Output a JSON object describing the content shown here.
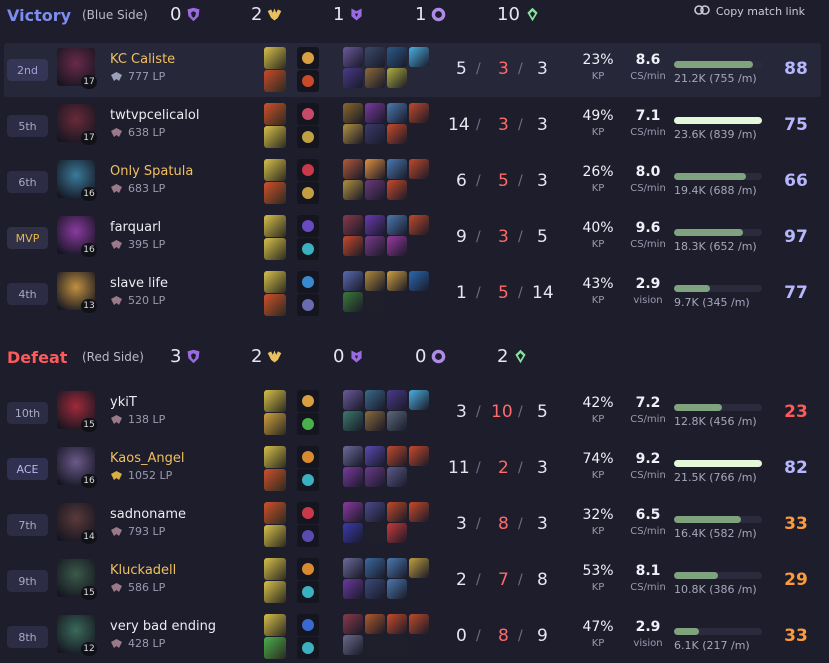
{
  "actions": {
    "copy_link_label": "Copy match link",
    "copy_icon": "link-icon"
  },
  "teams": [
    {
      "result": "Victory",
      "side": "(Blue Side)",
      "result_color": "#7f8cf0",
      "objectives": {
        "barons": "0",
        "dragons": "2",
        "heralds": "1",
        "grubs": "1",
        "turrets": "10"
      },
      "players": [
        {
          "rank": "2nd",
          "name": "KC Caliste",
          "name_gold": true,
          "level": "17",
          "lp": "777 LP",
          "emblem_color": "#9aa0b8",
          "spell_colors": [
            "#d8c04a",
            "#c84a2a"
          ],
          "rune_colors": [
            "#d8a040",
            "#c84a2a"
          ],
          "item_colors": [
            "#6a5a9a",
            "#3a4a6a",
            "#2a5a8a",
            "#4ab0e0",
            "#4a3a8a",
            "#8a6a3a",
            "#b0b040"
          ],
          "kills": "5",
          "deaths": "3",
          "assists": "3",
          "kp": "23%",
          "cs": "8.6",
          "cs_label": "CS/min",
          "dmg_fraction": 0.9,
          "dmg": "21.2K (755 /m)",
          "score": "88",
          "score_color": "#b7b7ff",
          "portrait_color": "#6a2a4a",
          "highlight": true
        },
        {
          "rank": "5th",
          "name": "twtvpcelicalol",
          "name_gold": false,
          "level": "17",
          "lp": "638 LP",
          "emblem_color": "#9a7a8a",
          "spell_colors": [
            "#d0502a",
            "#d8c04a"
          ],
          "rune_colors": [
            "#c84a6a",
            "#c0a040"
          ],
          "item_colors": [
            "#8a6a2a",
            "#7a3aa0",
            "#4a7ab0",
            "#c04a2a",
            "#b09040",
            "#3a3a6a",
            "#c84a2a"
          ],
          "kills": "14",
          "deaths": "3",
          "assists": "3",
          "kp": "49%",
          "cs": "7.1",
          "cs_label": "CS/min",
          "dmg_fraction": 1.0,
          "dmg": "23.6K (839 /m)",
          "score": "75",
          "score_color": "#b7b7ff",
          "portrait_color": "#6a2a3a",
          "highlight": false
        },
        {
          "rank": "6th",
          "name": "Only Spatula",
          "name_gold": true,
          "level": "16",
          "lp": "683 LP",
          "emblem_color": "#9a7a8a",
          "spell_colors": [
            "#d8c04a",
            "#d0502a"
          ],
          "rune_colors": [
            "#c83a4a",
            "#c0a040"
          ],
          "item_colors": [
            "#b05a3a",
            "#e09040",
            "#4a7ab0",
            "#c04a2a",
            "#b09040",
            "#6a3a7a",
            "#c84a2a"
          ],
          "kills": "6",
          "deaths": "5",
          "assists": "3",
          "kp": "26%",
          "cs": "8.0",
          "cs_label": "CS/min",
          "dmg_fraction": 0.82,
          "dmg": "19.4K (688 /m)",
          "score": "66",
          "score_color": "#b7b7ff",
          "portrait_color": "#3a7a9a",
          "highlight": false
        },
        {
          "rank": "MVP",
          "name": "farquarl",
          "name_gold": false,
          "level": "16",
          "lp": "395 LP",
          "emblem_color": "#9a7a8a",
          "spell_colors": [
            "#d8c04a",
            "#d8c04a"
          ],
          "rune_colors": [
            "#6a4ac0",
            "#3ab0c0"
          ],
          "item_colors": [
            "#8a3a4a",
            "#6a3ab0",
            "#4a7ab0",
            "#c04a2a",
            "#c84a2a",
            "#7a3a8a",
            "#9a3aa0"
          ],
          "kills": "9",
          "deaths": "3",
          "assists": "5",
          "kp": "40%",
          "cs": "9.6",
          "cs_label": "CS/min",
          "dmg_fraction": 0.78,
          "dmg": "18.3K (652 /m)",
          "score": "97",
          "score_color": "#b7b7ff",
          "portrait_color": "#8a3aa0",
          "highlight": false
        },
        {
          "rank": "4th",
          "name": "slave life",
          "name_gold": false,
          "level": "13",
          "lp": "520 LP",
          "emblem_color": "#9a7a8a",
          "spell_colors": [
            "#d8c04a",
            "#d0502a"
          ],
          "rune_colors": [
            "#3a8ad0",
            "#6a6ab0"
          ],
          "item_colors": [
            "#5a6ab0",
            "#b08a3a",
            "#d0a040",
            "#2a6ab0",
            "#3a7a3a",
            "#1f1f2c"
          ],
          "kills": "1",
          "deaths": "5",
          "assists": "14",
          "kp": "43%",
          "cs": "2.9",
          "cs_label": "vision",
          "dmg_fraction": 0.41,
          "dmg": "9.7K (345 /m)",
          "score": "77",
          "score_color": "#b7b7ff",
          "portrait_color": "#c09040",
          "highlight": false
        }
      ]
    },
    {
      "result": "Defeat",
      "side": "(Red Side)",
      "result_color": "#ff5a5a",
      "objectives": {
        "barons": "3",
        "dragons": "2",
        "heralds": "0",
        "grubs": "0",
        "turrets": "2"
      },
      "players": [
        {
          "rank": "10th",
          "name": "ykiT",
          "name_gold": false,
          "level": "15",
          "lp": "138 LP",
          "emblem_color": "#9a7a8a",
          "spell_colors": [
            "#d8c04a",
            "#d0a040"
          ],
          "rune_colors": [
            "#d8a040",
            "#4ab04a"
          ],
          "item_colors": [
            "#6a5a9a",
            "#3a6a8a",
            "#4a3a8a",
            "#4ab0e0",
            "#3a7a6a",
            "#8a6a3a",
            "#5a6a7a"
          ],
          "kills": "3",
          "deaths": "10",
          "assists": "5",
          "kp": "42%",
          "cs": "7.2",
          "cs_label": "CS/min",
          "dmg_fraction": 0.55,
          "dmg": "12.8K (456 /m)",
          "score": "23",
          "score_color": "#ff5a5a",
          "portrait_color": "#a02a3a",
          "highlight": false
        },
        {
          "rank": "ACE",
          "name": "Kaos_Angel",
          "name_gold": true,
          "level": "16",
          "lp": "1052 LP",
          "emblem_color": "#d8b040",
          "spell_colors": [
            "#d8c04a",
            "#d0502a"
          ],
          "rune_colors": [
            "#d88a30",
            "#3ab0c0"
          ],
          "item_colors": [
            "#6a6a9a",
            "#5a4ab0",
            "#c04a2a",
            "#c84a2a",
            "#7a3aa0",
            "#6a3a8a",
            "#5a5a8a"
          ],
          "kills": "11",
          "deaths": "2",
          "assists": "3",
          "kp": "74%",
          "cs": "9.2",
          "cs_label": "CS/min",
          "dmg_fraction": 1.0,
          "dmg": "21.5K (766 /m)",
          "score": "82",
          "score_color": "#b7b7ff",
          "portrait_color": "#6a5a8a",
          "highlight": false
        },
        {
          "rank": "7th",
          "name": "sadnoname",
          "name_gold": false,
          "level": "14",
          "lp": "793 LP",
          "emblem_color": "#9a7a8a",
          "spell_colors": [
            "#d0502a",
            "#d8c04a"
          ],
          "rune_colors": [
            "#c83a4a",
            "#5a4ab0"
          ],
          "item_colors": [
            "#8a3aa0",
            "#4a4a8a",
            "#c04a2a",
            "#c84a2a",
            "#3a3ab0",
            "#1f1f2c",
            "#c83a3a"
          ],
          "kills": "3",
          "deaths": "8",
          "assists": "3",
          "kp": "32%",
          "cs": "6.5",
          "cs_label": "CS/min",
          "dmg_fraction": 0.76,
          "dmg": "16.4K (582 /m)",
          "score": "33",
          "score_color": "#ff9a3a",
          "portrait_color": "#5a3a3a",
          "highlight": false
        },
        {
          "rank": "9th",
          "name": "Kluckadell",
          "name_gold": true,
          "level": "15",
          "lp": "586 LP",
          "emblem_color": "#9a7a8a",
          "spell_colors": [
            "#d8c04a",
            "#d8c04a"
          ],
          "rune_colors": [
            "#d88a30",
            "#3ab0c0"
          ],
          "item_colors": [
            "#6a6a9a",
            "#3a6aa0",
            "#4a7ab0",
            "#c0a040",
            "#6a3aa0",
            "#3a4a7a",
            "#4a7ab0"
          ],
          "kills": "2",
          "deaths": "7",
          "assists": "8",
          "kp": "53%",
          "cs": "8.1",
          "cs_label": "CS/min",
          "dmg_fraction": 0.5,
          "dmg": "10.8K (386 /m)",
          "score": "29",
          "score_color": "#ff9a3a",
          "portrait_color": "#3a5a4a",
          "highlight": false
        },
        {
          "rank": "8th",
          "name": "very bad ending",
          "name_gold": false,
          "level": "12",
          "lp": "428 LP",
          "emblem_color": "#9a7a8a",
          "spell_colors": [
            "#d8c04a",
            "#4ab04a"
          ],
          "rune_colors": [
            "#3a6ad0",
            "#3ab0c0"
          ],
          "item_colors": [
            "#8a3a4a",
            "#b05a2a",
            "#c84a2a",
            "#c04a2a",
            "#6a6a8a",
            "#1f1f2c",
            "#1f1f2c"
          ],
          "kills": "0",
          "deaths": "8",
          "assists": "9",
          "kp": "47%",
          "cs": "2.9",
          "cs_label": "vision",
          "dmg_fraction": 0.28,
          "dmg": "6.1K (217 /m)",
          "score": "33",
          "score_color": "#ff9a3a",
          "portrait_color": "#3a6a5a",
          "highlight": false
        }
      ]
    }
  ],
  "labels": {
    "kp_label": "KP",
    "kda_sep": "/"
  },
  "icons": {
    "baron": "baron-icon",
    "dragon": "dragon-icon",
    "herald": "herald-icon",
    "grub": "grub-icon",
    "turret": "turret-icon"
  }
}
